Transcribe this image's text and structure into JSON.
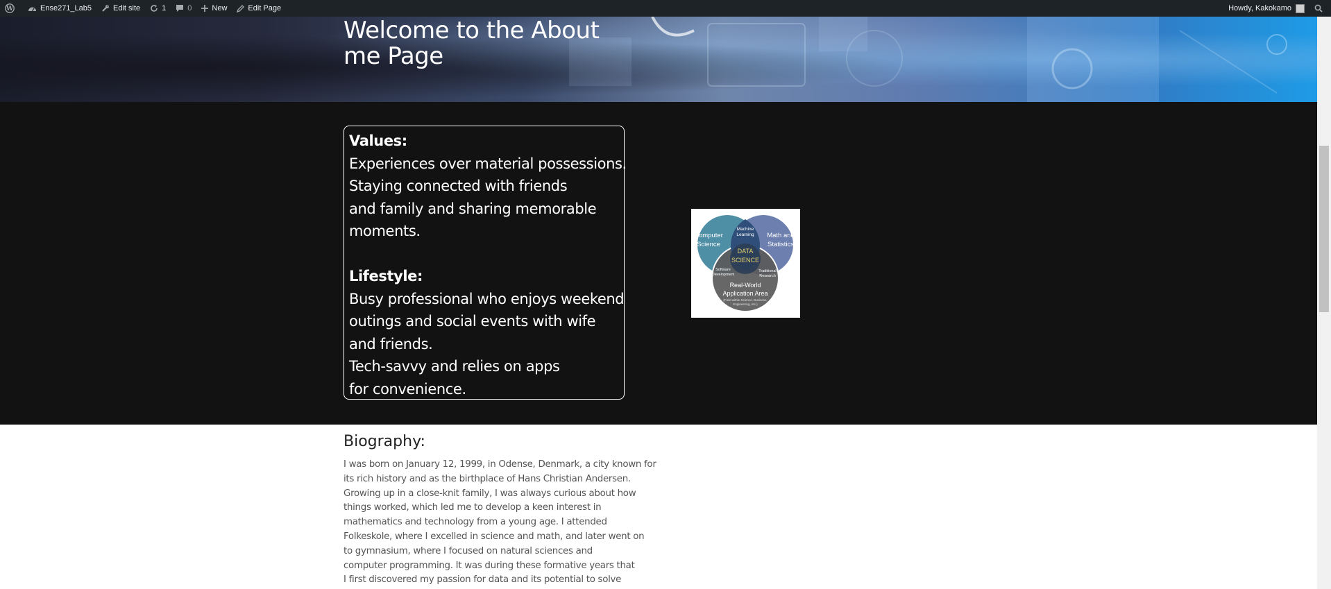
{
  "adminbar": {
    "site_name": "Ense271_Lab5",
    "edit_site": "Edit site",
    "updates_count": "1",
    "comments_count": "0",
    "new_label": "New",
    "edit_page": "Edit Page",
    "greeting": "Howdy, Kakokamo"
  },
  "hero": {
    "title_line1": "Welcome to the About",
    "title_line2": "me Page"
  },
  "values": {
    "values_heading": "Values:",
    "values_lines": [
      "Experiences over material possessions.",
      "Staying connected with friends",
      "and family and sharing memorable",
      "moments."
    ],
    "lifestyle_heading": "Lifestyle:",
    "lifestyle_lines": [
      "Busy professional who enjoys weekend",
      "outings and social events with wife",
      "and friends.",
      "Tech-savvy and relies on apps",
      "for convenience."
    ]
  },
  "venn": {
    "cs_line1": "Computer",
    "cs_line2": "Science",
    "ms_line1": "Math and",
    "ms_line2": "Statistics",
    "ml_line1": "Machine",
    "ml_line2": "Learning",
    "ds_line1": "DATA",
    "ds_line2": "SCIENCE",
    "sd_line1": "Software",
    "sd_line2": "Development",
    "tr_line1": "Traditional",
    "tr_line2": "Research",
    "rw_line1": "Real-World",
    "rw_line2": "Application Area",
    "rw_sub1": "(Field within Science, Business,",
    "rw_sub2": "Engineering, etc.)"
  },
  "bio": {
    "heading": "Biography:",
    "lines": [
      "I was born on January 12, 1999, in Odense, Denmark, a city known for",
      "its rich history and as the birthplace of Hans Christian Andersen.",
      "Growing up in a close-knit family, I was always curious about how",
      "things worked, which led me to develop a keen interest in",
      "mathematics and technology from a young age. I attended",
      "Folkeskole, where I excelled in science and math, and later went on",
      "to gymnasium, where I focused on natural sciences and",
      "computer programming. It was during these formative years that",
      "I first discovered my passion for data and its potential to solve"
    ]
  }
}
